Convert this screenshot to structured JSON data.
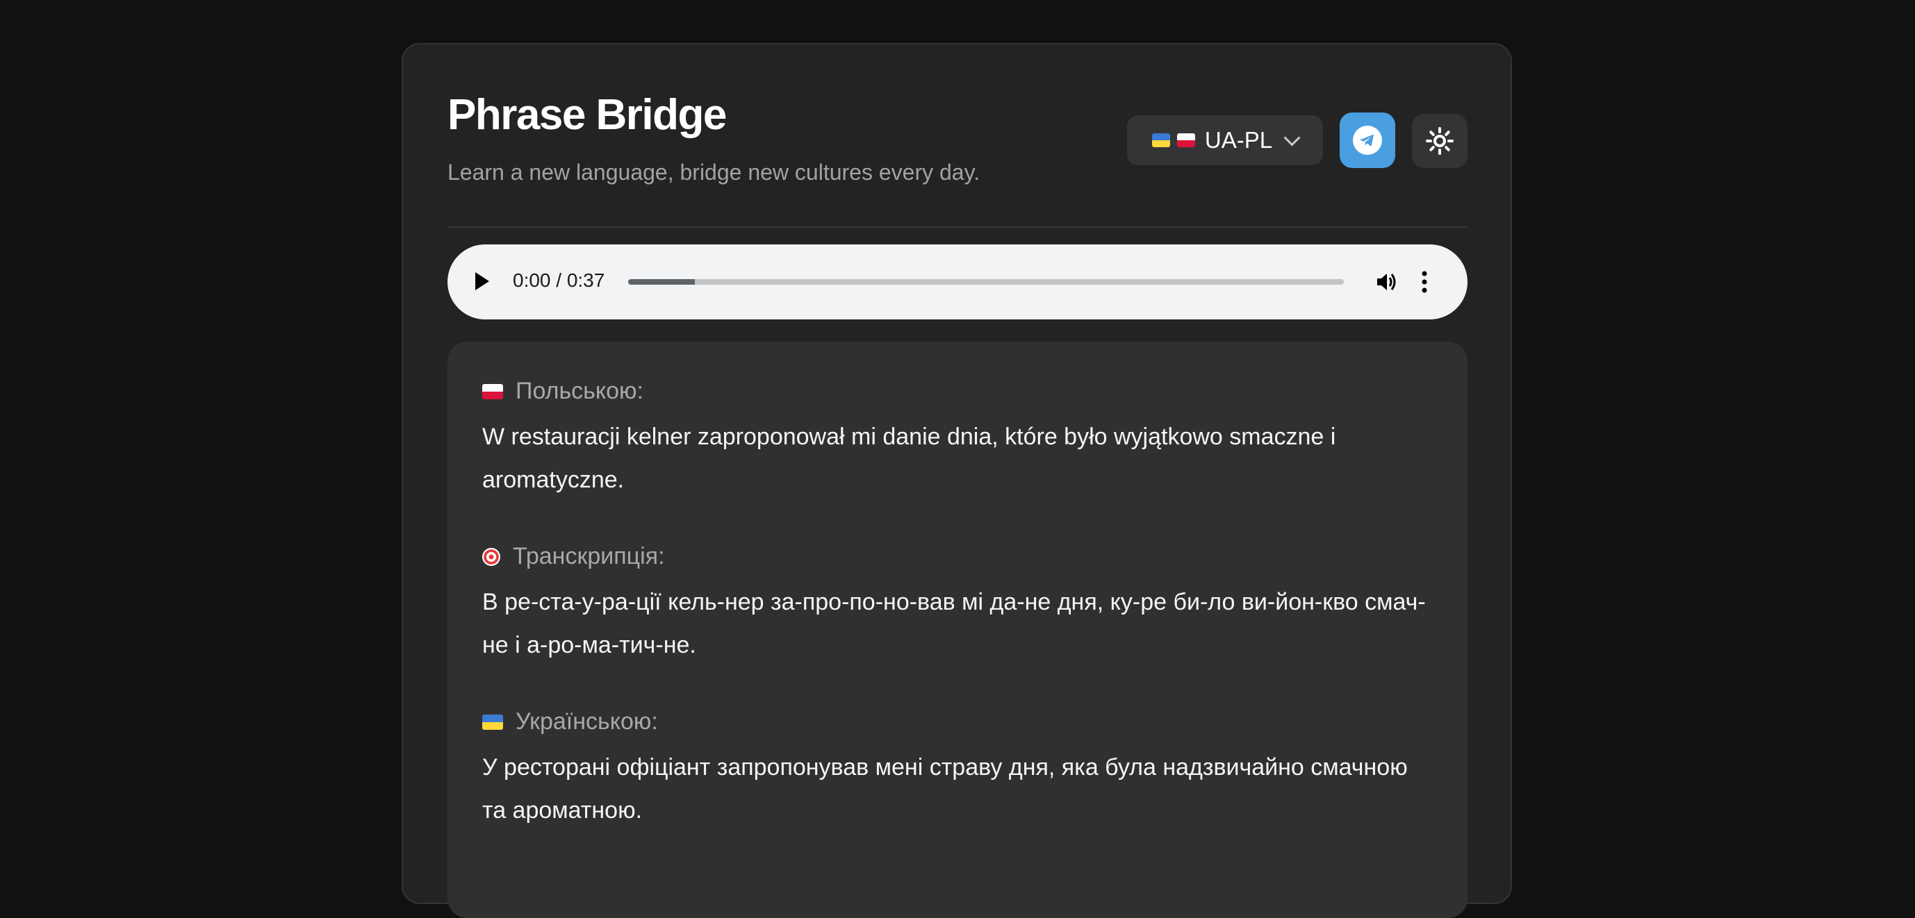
{
  "header": {
    "title": "Phrase Bridge",
    "subtitle": "Learn a new language, bridge new cultures every day."
  },
  "language_selector": {
    "label": "UA-PL",
    "flags": [
      "ua-flag",
      "pl-flag"
    ]
  },
  "buttons": {
    "telegram": {
      "icon": "telegram-icon",
      "color": "#4a9fe0"
    },
    "theme": {
      "icon": "sun-icon"
    }
  },
  "audio": {
    "time": "0:00 / 0:37",
    "progress_buffered": 0.093
  },
  "phrase": {
    "polish": {
      "icon": "pl-flag",
      "label": "Польською:",
      "text": "W restauracji kelner zaproponował mi danie dnia, które było wyjątkowo smaczne i aromatyczne."
    },
    "transcription": {
      "icon": "target-icon",
      "label": "Транскрипція:",
      "text": "В ре-ста-у-ра-ції кель-нер за-про-по-но-вав мі да-не дня, ку-ре би-ло ви-йон-кво смач-не і а-ро-ма-тич-не."
    },
    "ukrainian": {
      "icon": "ua-flag",
      "label": "Українською:",
      "text": "У ресторані офіціант запропонував мені страву дня, яка була надзвичайно смачною та ароматною."
    }
  },
  "colors": {
    "background": "#111112",
    "card": "#232324",
    "panel": "#303031",
    "accent": "#4a9fe0"
  }
}
